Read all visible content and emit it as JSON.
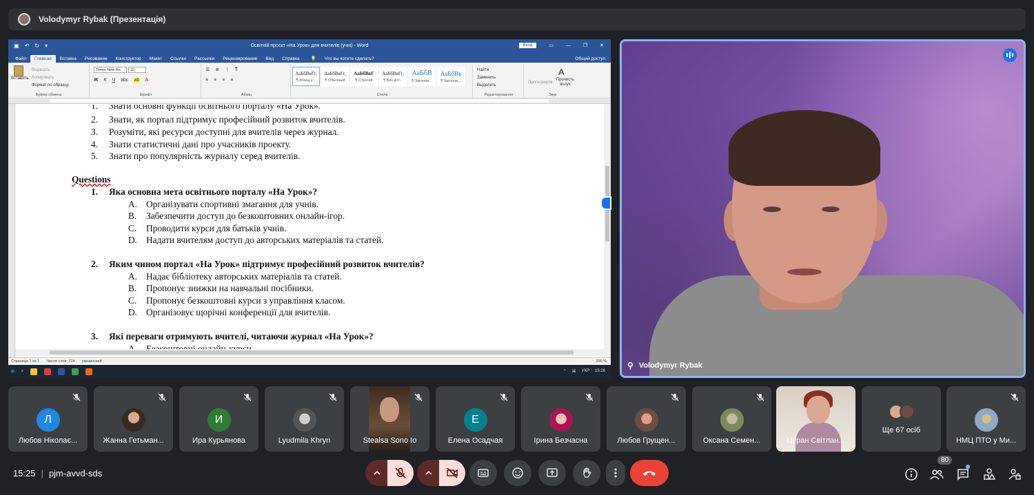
{
  "presenter_bar": {
    "title": "Volodymyr Rybak (Презентація)"
  },
  "word": {
    "title": "Освітній проєкт «На Урок» для вчителів (учні) - Word",
    "signin": "Вход",
    "menu": [
      "Файл",
      "Главная",
      "Вставка",
      "Рисование",
      "Конструктор",
      "Макет",
      "Ссылки",
      "Рассылки",
      "Рецензирование",
      "Вид",
      "Справка"
    ],
    "tell_me": "Что вы хотите сделать?",
    "share": "Общий доступ",
    "clipboard": {
      "paste": "Вставить",
      "cut": "Вырезать",
      "copy": "Копировать",
      "format": "Формат по образцу",
      "label": "Буфер обмена"
    },
    "font": {
      "name": "Times New Ro",
      "size": "10",
      "label": "Шрифт"
    },
    "paragraph_label": "Абзац",
    "styles": [
      {
        "sample": "АаБбВвГг,",
        "name": "¶ Абзац с..."
      },
      {
        "sample": "АаБбВвГг,",
        "name": "¶ Обычный"
      },
      {
        "sample": "АаБбВвГ",
        "name": "¶ Строгий"
      },
      {
        "sample": "АаБбВвГг,",
        "name": "¶ Без инт..."
      },
      {
        "sample": "АаБбВ",
        "name": "¶ Заголов..."
      },
      {
        "sample": "АаБбВв",
        "name": "¶ Заголов..."
      }
    ],
    "styles_label": "Стили",
    "editing": {
      "find": "Найти",
      "replace": "Заменить",
      "select": "Выделить",
      "label": "Редактирование"
    },
    "dictate": "Прогнозиров",
    "read_aloud": "Прочесть вслух",
    "voice_label": "Звук",
    "doc": {
      "list_top": [
        {
          "n": "1.",
          "t": "Знати основні функції освітнього порталу «На Урок»."
        },
        {
          "n": "2.",
          "t": "Знати, як портал підтримує професійний розвиток вчителів."
        },
        {
          "n": "3.",
          "t": "Розуміти, які ресурси доступні для вчителів через журнал."
        },
        {
          "n": "4.",
          "t": "Знати статистичні дані про учасників проекту."
        },
        {
          "n": "5.",
          "t": "Знати про популярність журналу серед вчителів."
        }
      ],
      "heading": "Questions",
      "q1": {
        "n": "1.",
        "t": "Яка основна мета освітнього порталу «На Урок»?",
        "opts": [
          {
            "l": "A.",
            "t": "Організувати спортивні змагання для учнів."
          },
          {
            "l": "B.",
            "t": "Забезпечити доступ до безкоштовних онлайн-ігор."
          },
          {
            "l": "C.",
            "t": "Проводити курси для батьків учнів."
          },
          {
            "l": "D.",
            "t": "Надати вчителям доступ до авторських матеріалів та статей."
          }
        ]
      },
      "q2": {
        "n": "2.",
        "t": "Яким чином портал «На Урок» підтримує професійний розвиток вчителів?",
        "opts": [
          {
            "l": "A.",
            "t": "Надає бібліотеку авторських матеріалів та статей."
          },
          {
            "l": "B.",
            "t": "Пропонує знижки на навчальні посібники."
          },
          {
            "l": "C.",
            "t": "Пропонує безкоштовні курси з управління класом."
          },
          {
            "l": "D.",
            "t": "Організовує щорічні конференції для вчителів."
          }
        ]
      },
      "q3": {
        "n": "3.",
        "t": "Які переваги отримують вчителі, читаючи журнал «На Урок»?",
        "opts": [
          {
            "l": "A.",
            "t": "Безкоштовні онлайн-курси"
          }
        ]
      }
    },
    "status": {
      "page": "Страница 1 из 1",
      "words": "Число слов: 224",
      "lang": "украинский",
      "zoom": "200 %"
    },
    "taskbar": {
      "lang": "УКР",
      "time": "15:26"
    }
  },
  "speaker": {
    "name": "Volodymyr Rybak"
  },
  "participants": [
    {
      "name": "Любов Ніколає...",
      "initial": "Л",
      "color": "#1e88e5"
    },
    {
      "name": "Жанна Гетьман...",
      "initial": "",
      "color": "#5d4037"
    },
    {
      "name": "Ира Курьянова",
      "initial": "И",
      "color": "#2e7d32"
    },
    {
      "name": "Lyudmila Khryn",
      "initial": "",
      "color": "#616161"
    },
    {
      "name": "Stealsa Sono Io",
      "initial": "",
      "color": ""
    },
    {
      "name": "Елена Осадчая",
      "initial": "Е",
      "color": "#00838f"
    },
    {
      "name": "Ірина Безчасна",
      "initial": "",
      "color": "#ad1457"
    },
    {
      "name": "Любов Грущен...",
      "initial": "",
      "color": "#6d4c41"
    },
    {
      "name": "Оксана Семен...",
      "initial": "",
      "color": "#7b8a5a"
    },
    {
      "name": "Цуран Світлан...",
      "initial": "",
      "color": ""
    },
    {
      "name": "Ще 67 осіб",
      "initial": "",
      "color": ""
    },
    {
      "name": "НМЦ ПТО у Ми...",
      "initial": "",
      "color": "#8fa9c4"
    }
  ],
  "bottom": {
    "time": "15:25",
    "meeting_code": "pjm-avvd-sds",
    "participants_count": "80"
  },
  "colors": {
    "accent": "#8ab4f8",
    "hangup": "#ea4335",
    "bg": "#202124"
  }
}
